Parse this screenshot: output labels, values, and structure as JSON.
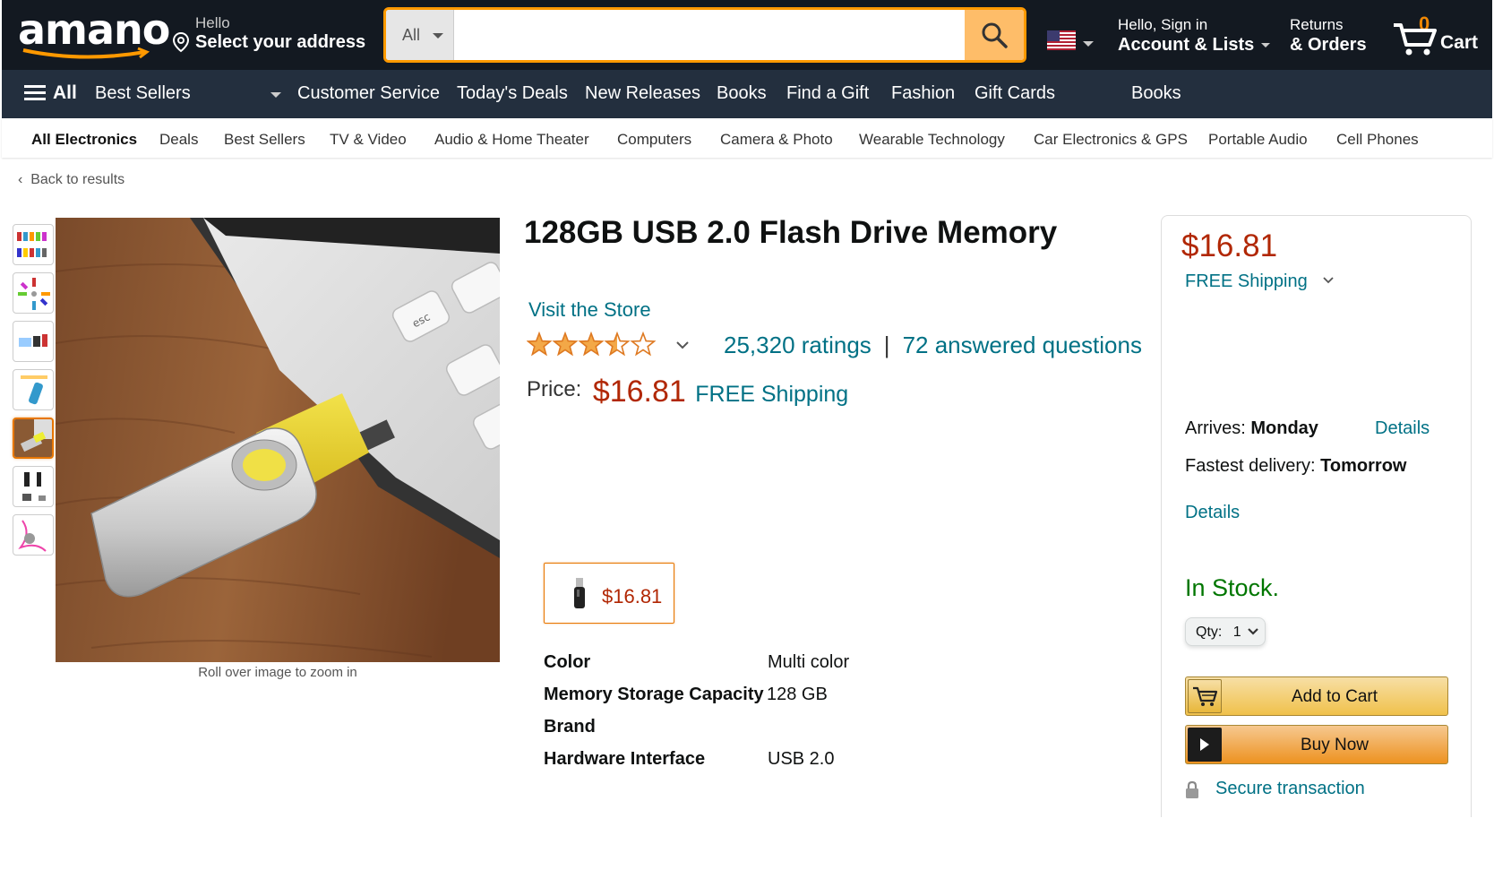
{
  "header": {
    "logo": "amano",
    "address_line1": "Hello",
    "address_line2": "Select your address",
    "search_category": "All",
    "search_placeholder": "",
    "account_line1": "Hello, Sign in",
    "account_line2": "Account & Lists",
    "returns_line1": "Returns",
    "returns_line2": "& Orders",
    "cart_count": "0",
    "cart_label": "Cart"
  },
  "nav": {
    "all": "All",
    "items": [
      "Best Sellers",
      "Customer Service",
      "Today's Deals",
      "New Releases",
      "Books",
      "Find a Gift",
      "Fashion",
      "Gift Cards",
      "Books"
    ]
  },
  "subnav": {
    "items": [
      "All Electronics",
      "Deals",
      "Best Sellers",
      "TV & Video",
      "Audio & Home Theater",
      "Computers",
      "Camera & Photo",
      "Wearable Technology",
      "Car Electronics & GPS",
      "Portable Audio",
      "Cell Phones"
    ]
  },
  "back_link": "Back to results",
  "gallery": {
    "zoom_hint": "Roll over image to zoom in"
  },
  "product": {
    "title": "128GB USB 2.0 Flash Drive Memory",
    "store_link": "Visit the Store",
    "rating_value": 3.5,
    "ratings_count": "25,320 ratings",
    "separator": "|",
    "answered_questions": "72 answered questions",
    "price_label": "Price:",
    "price": "$16.81",
    "shipping": "FREE Shipping",
    "swatch_price": "$16.81",
    "specs": [
      {
        "key": "Color",
        "value": "Multi color"
      },
      {
        "key": "Memory Storage Capacity",
        "value": "128 GB"
      },
      {
        "key": "Brand",
        "value": ""
      },
      {
        "key": "Hardware Interface",
        "value": "USB 2.0"
      }
    ]
  },
  "buybox": {
    "price": "$16.81",
    "shipping": "FREE Shipping",
    "arrives_label": "Arrives:",
    "arrives_day": "Monday",
    "details1": "Details",
    "fastest_label": "Fastest delivery:",
    "fastest_day": "Tomorrow",
    "details2": "Details",
    "stock": "In Stock.",
    "qty_label": "Qty:",
    "qty_value": "1",
    "add_to_cart": "Add to Cart",
    "buy_now": "Buy Now",
    "secure": "Secure transaction"
  },
  "colors": {
    "header_bg": "#131921",
    "nav_bg": "#232f3e",
    "price": "#b12704",
    "link": "#007185",
    "in_stock": "#007600",
    "search_accent": "#febd69"
  }
}
